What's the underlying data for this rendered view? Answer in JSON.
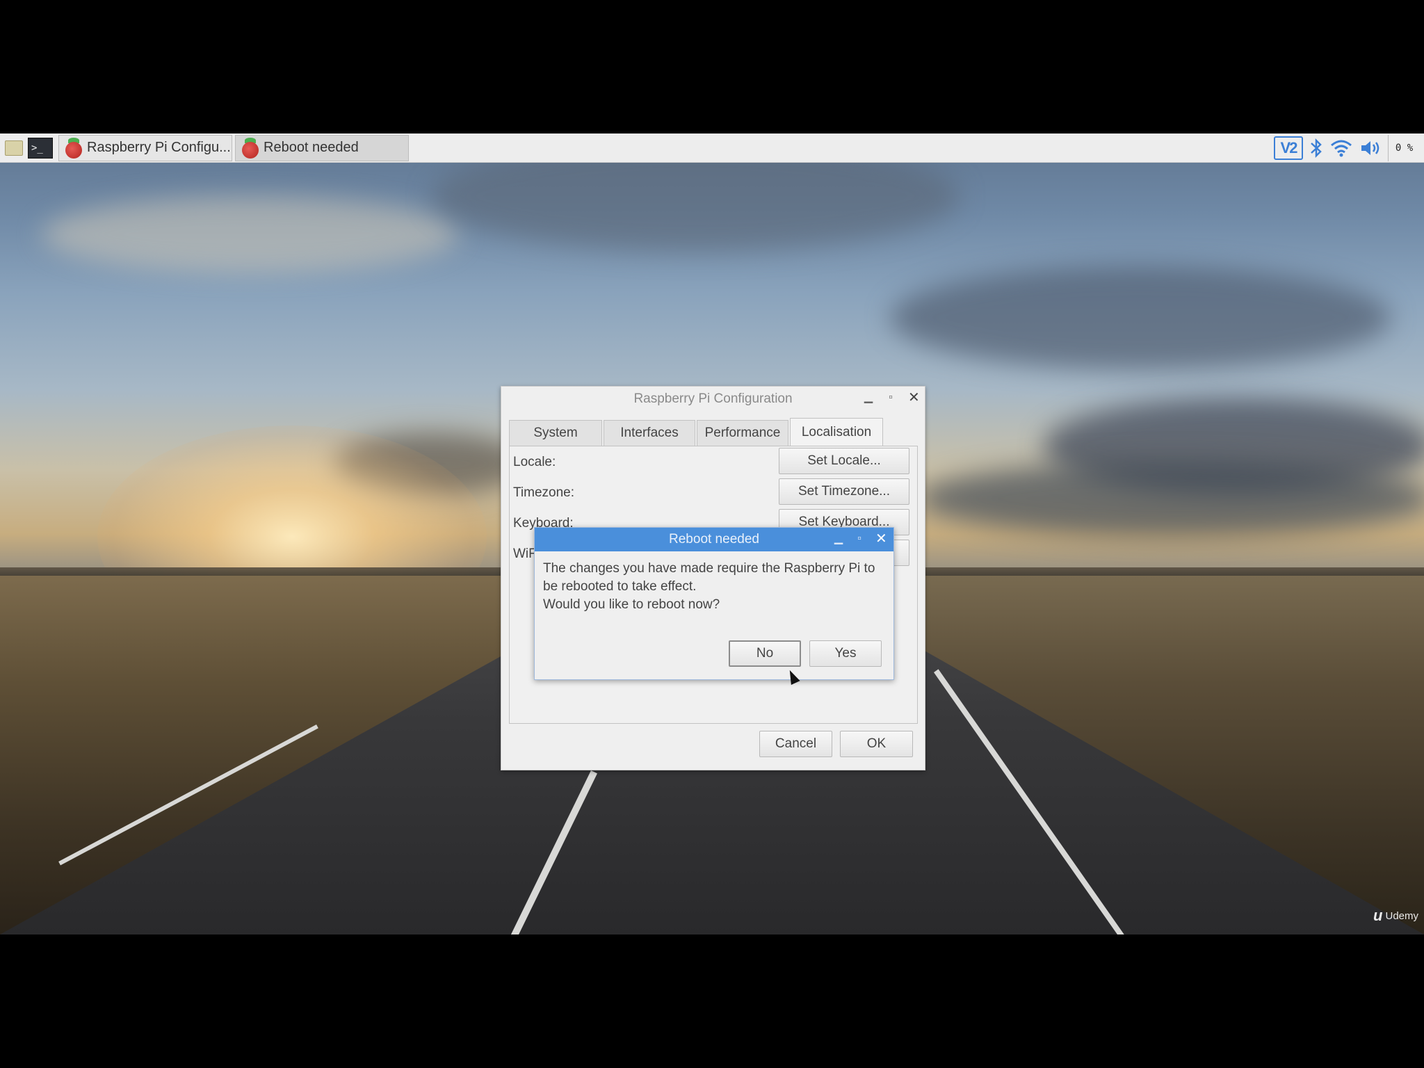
{
  "taskbar": {
    "tasks": [
      {
        "label": "Raspberry Pi Configu..."
      },
      {
        "label": "Reboot needed"
      }
    ],
    "tray": {
      "vnc": "V2",
      "cpu": "0 %"
    }
  },
  "config_window": {
    "title": "Raspberry Pi Configuration",
    "tabs": [
      "System",
      "Interfaces",
      "Performance",
      "Localisation"
    ],
    "active_tab": "Localisation",
    "rows": [
      {
        "label": "Locale:",
        "button": "Set Locale..."
      },
      {
        "label": "Timezone:",
        "button": "Set Timezone..."
      },
      {
        "label": "Keyboard:",
        "button": "Set Keyboard..."
      },
      {
        "label": "WiFi",
        "button": "..."
      }
    ],
    "cancel_label": "Cancel",
    "ok_label": "OK"
  },
  "dialog": {
    "title": "Reboot needed",
    "message": "The changes you have made require the Raspberry Pi to be rebooted to take effect.",
    "question": "Would you like to reboot now?",
    "no_label": "No",
    "yes_label": "Yes"
  },
  "watermark": {
    "logo": "u",
    "text": "Udemy"
  },
  "colors": {
    "dialog_title_bg": "#4a8fdb",
    "tray_accent": "#3b7fd6"
  }
}
